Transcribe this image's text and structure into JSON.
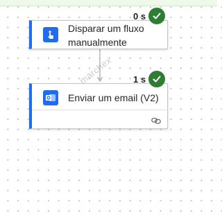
{
  "flow": {
    "trigger": {
      "title": "Disparar um fluxo manualmente",
      "icon": "hand-tap-icon",
      "duration": "0 s",
      "status_icon": "checkmark-circle-icon"
    },
    "action": {
      "title": "Enviar um email (V2)",
      "icon": "outlook-icon",
      "duration": "1 s",
      "status_icon": "checkmark-circle-icon",
      "footer_icon": "link-icon"
    }
  },
  "watermark": "marchex",
  "colors": {
    "accent": "#1f6cf0",
    "success": "#2d7d32"
  }
}
